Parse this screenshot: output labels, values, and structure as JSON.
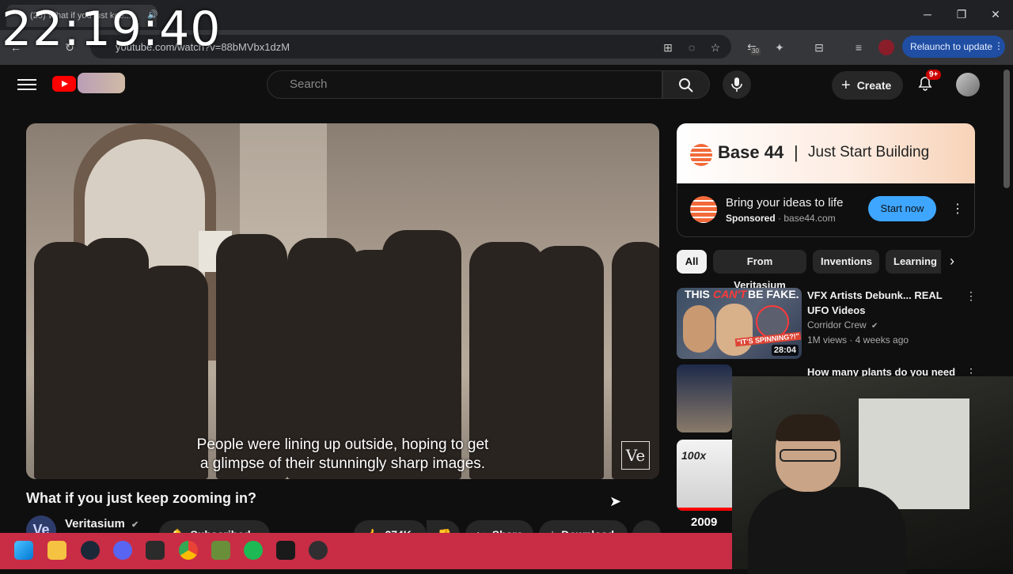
{
  "clock": "22:19:40",
  "browser": {
    "tab_title": "(25) What if you just kee...",
    "url": "youtube.com/watch?v=88bMVbx1dzM",
    "extension_count": "30",
    "relaunch_label": "Relaunch to update"
  },
  "header": {
    "search_placeholder": "Search",
    "create_label": "Create",
    "notifications_badge": "9+"
  },
  "video": {
    "caption_line1": "People were lining up outside, hoping to get",
    "caption_line2": "a glimpse of their stunningly sharp images.",
    "watermark": "Ve",
    "title": "What if you just keep zooming in?",
    "channel_avatar": "Ve",
    "channel_name": "Veritasium",
    "subscribed_label": "Subscribed",
    "like_count": "274K",
    "share_label": "Share",
    "download_label": "Download"
  },
  "ad": {
    "brand": "Base 44",
    "separator": "|",
    "tagline": "Just Start Building",
    "headline": "Bring your ideas to life",
    "sponsored_label": "Sponsored",
    "domain": "base44.com",
    "cta_label": "Start now"
  },
  "chips": [
    "All",
    "From Veritasium",
    "Inventions",
    "Learning"
  ],
  "recommendations": [
    {
      "title": "VFX Artists Debunk... REAL UFO Videos",
      "channel": "Corridor Crew",
      "meta": "1M views · 4 weeks ago",
      "duration": "28:04",
      "thumb_text1": "THIS",
      "thumb_text2": "CAN'T",
      "thumb_text3": "BE FAKE.",
      "thumb_text4": "\"IT'S SPINNING?!\""
    },
    {
      "title": "How many plants do you need"
    },
    {
      "thumb_text": "100x"
    },
    {
      "thumb_text": "2009"
    }
  ],
  "icons": {
    "menu": "menu-icon",
    "search": "search-icon",
    "mic": "mic-icon",
    "bell": "bell-icon"
  },
  "colors": {
    "youtube_red": "#ff0000",
    "cta_blue": "#3ea6ff",
    "taskbar": "#c82d45",
    "relaunch": "#1f4ea3"
  }
}
